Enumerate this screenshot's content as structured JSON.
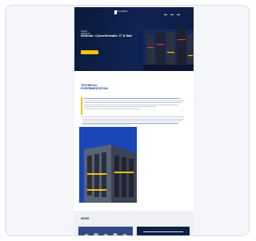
{
  "colors": {
    "navy": "#0b1a3a",
    "brand_blue": "#1a3d8f",
    "accent_yellow": "#f5c400",
    "image_blue": "#1a46b8"
  },
  "hero": {
    "logo_text": "RILLARD",
    "kicker": "EVENT",
    "kicker2": "WEBINAR",
    "title": "Webinar: Cyberfirewalls: IT & Wat",
    "subtitle": "",
    "cta_label": "",
    "pager": "• • • •"
  },
  "section": {
    "title_line1": "TECHNICAL",
    "title_line2": "EXPERIMENTATION"
  },
  "bottom": {
    "title": "NEWS"
  }
}
